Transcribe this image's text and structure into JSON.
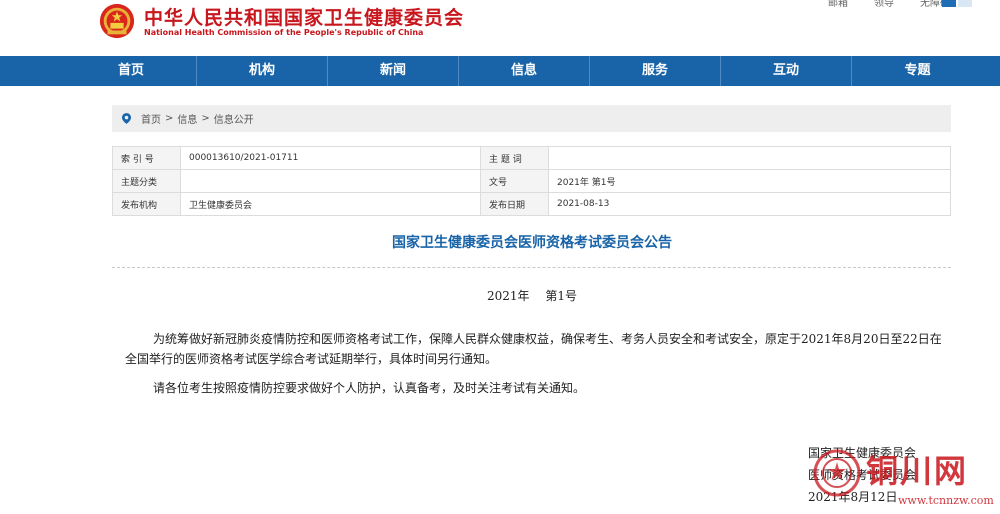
{
  "header": {
    "title_cn": "中华人民共和国国家卫生健康委员会",
    "title_en": "National Health Commission of the People's Republic of China",
    "top_links": [
      "邮箱",
      "领导",
      "无障碍"
    ]
  },
  "nav": {
    "items": [
      "首页",
      "机构",
      "新闻",
      "信息",
      "服务",
      "互动",
      "专题"
    ]
  },
  "breadcrumb": {
    "items": [
      "首页",
      "信息",
      "信息公开"
    ],
    "separator": ">"
  },
  "meta": {
    "index_label": "索 引 号",
    "index_value": "000013610/2021-01711",
    "subject_label": "主 题 词",
    "subject_value": "",
    "category_label": "主题分类",
    "category_value": "",
    "docno_label": "文号",
    "docno_value": "2021年 第1号",
    "publisher_label": "发布机构",
    "publisher_value": "卫生健康委员会",
    "date_label": "发布日期",
    "date_value": "2021-08-13"
  },
  "article": {
    "title": "国家卫生健康委员会医师资格考试委员会公告",
    "doc_number": "2021年　 第1号",
    "paragraph_1": "为统筹做好新冠肺炎疫情防控和医师资格考试工作，保障人民群众健康权益，确保考生、考务人员安全和考试安全，原定于2021年8月20日至22日在全国举行的医师资格考试医学综合考试延期举行，具体时间另行通知。",
    "paragraph_2": "请各位考生按照疫情防控要求做好个人防护，认真备考，及时关注考试有关通知。",
    "signature_line_1": "国家卫生健康委员会",
    "signature_line_2": "医师资格考试委员会",
    "signature_date": "2021年8月12日"
  },
  "watermark": {
    "text": "铜川网",
    "url": "www.tcnnzw.com"
  },
  "colors": {
    "brand_red": "#c8161d",
    "nav_blue": "#1964a8"
  }
}
